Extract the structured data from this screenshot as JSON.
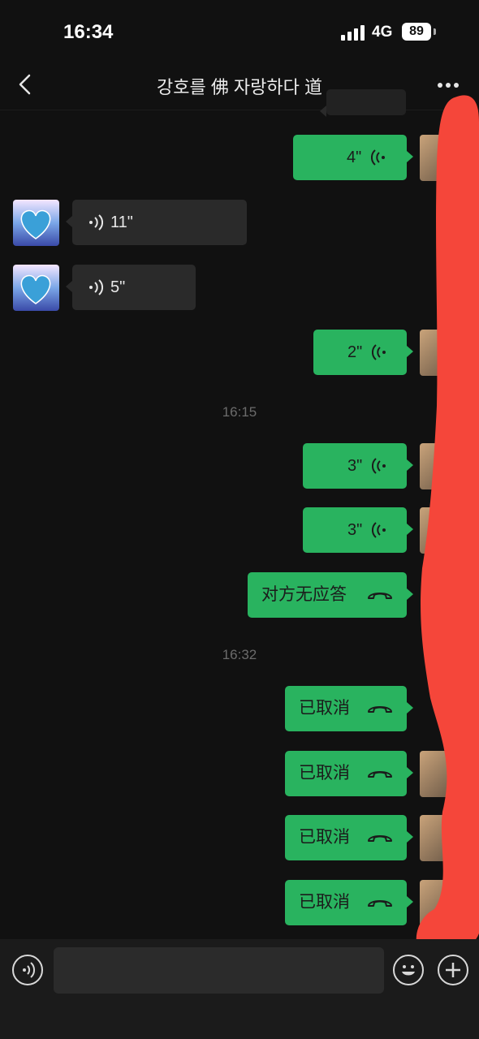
{
  "status_bar": {
    "time": "16:34",
    "network": "4G",
    "battery": "89"
  },
  "header": {
    "title": "강호를 佛 자랑하다 道"
  },
  "messages": {
    "m1": {
      "duration": "4\""
    },
    "m2": {
      "duration": "11\""
    },
    "m3": {
      "duration": "5\""
    },
    "m4": {
      "duration": "2\""
    },
    "t1": "16:15",
    "m5": {
      "duration": "3\""
    },
    "m6": {
      "duration": "3\""
    },
    "m7": {
      "text": "对方无应答"
    },
    "t2": "16:32",
    "m8": {
      "text": "已取消"
    },
    "m9": {
      "text": "已取消"
    },
    "m10": {
      "text": "已取消"
    },
    "m11": {
      "text": "已取消"
    }
  },
  "colors": {
    "outgoing_bubble": "#29b35f",
    "incoming_bubble": "#2a2a2a",
    "background": "#111111",
    "redaction": "#f5463a"
  },
  "icons": [
    "back-icon",
    "more-icon",
    "voice-wave-icon",
    "phone-hangup-icon",
    "voice-input-icon",
    "emoji-icon",
    "plus-icon"
  ]
}
